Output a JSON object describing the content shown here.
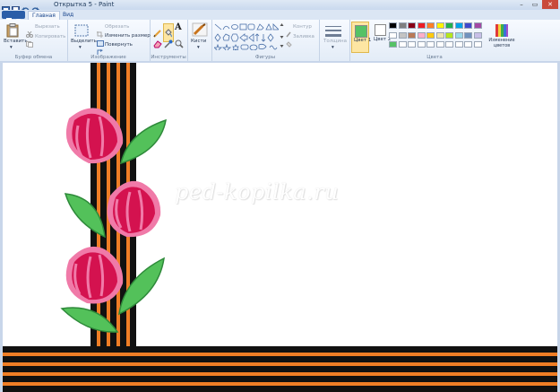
{
  "window": {
    "title": "Открытка 5 - Paint"
  },
  "tabs": [
    {
      "label": "Главная",
      "active": true
    },
    {
      "label": "Вид",
      "active": false
    }
  ],
  "clipboard": {
    "paste_label": "Вставить",
    "cut_label": "Вырезать",
    "copy_label": "Копировать",
    "group_label": "Буфер обмена"
  },
  "image": {
    "select_label": "Выделить",
    "crop_label": "Обрезать",
    "resize_label": "Изменить размер",
    "rotate_label": "Повернуть",
    "group_label": "Изображение"
  },
  "tools": {
    "group_label": "Инструменты"
  },
  "brushes": {
    "label": "Кисти"
  },
  "shapes": {
    "outline_label": "Контур",
    "fill_label": "Заливка",
    "group_label": "Фигуры"
  },
  "size": {
    "label": "Толщина"
  },
  "colors": {
    "color1_label": "Цвет 1",
    "color2_label": "Цвет 2",
    "color1_value": "#55c266",
    "color2_value": "#ffffff",
    "edit_label": "Изменение цветов",
    "group_label": "Цвета",
    "palette_row1": [
      "#000000",
      "#7f7f7f",
      "#880015",
      "#ed1c24",
      "#ff7f27",
      "#fff200",
      "#22b14c",
      "#00a2e8",
      "#3f48cc",
      "#a349a4"
    ],
    "palette_row2": [
      "#ffffff",
      "#c3c3c3",
      "#b97a57",
      "#ffaec9",
      "#ffc90e",
      "#efe4b0",
      "#b5e61d",
      "#99d9ea",
      "#7092be",
      "#c8bfe7"
    ],
    "palette_row3": [
      "#55c266",
      "#ffffff",
      "#ffffff",
      "#ffffff",
      "#ffffff",
      "#ffffff",
      "#ffffff",
      "#ffffff",
      "#ffffff",
      "#ffffff"
    ]
  },
  "canvas": {
    "watermark": "ped-kopilka.ru",
    "ribbon_black": "#111111",
    "ribbon_orange": "#f07e26",
    "petal_color": "#d4124f",
    "petal_edge": "#f07aa8",
    "leaf_color": "#53c15a",
    "leaf_edge": "#2e8a3a"
  }
}
